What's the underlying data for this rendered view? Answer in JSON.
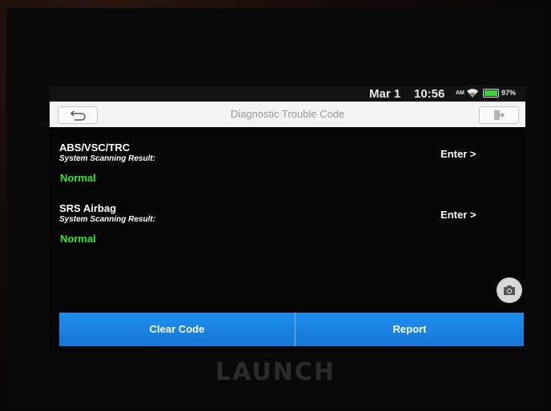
{
  "status_bar": {
    "date": "Mar 1",
    "time": "10:56",
    "ampm": "AM",
    "battery_percent": "97%",
    "battery_level": 0.97,
    "icons": [
      "wifi-icon",
      "battery-icon"
    ]
  },
  "header": {
    "title": "Diagnostic Trouble Code",
    "back_icon": "back-arrow-icon",
    "exit_icon": "exit-icon"
  },
  "systems": [
    {
      "name": "ABS/VSC/TRC",
      "result_label": "System Scanning Result:",
      "status": "Normal",
      "action": "Enter >"
    },
    {
      "name": "SRS Airbag",
      "result_label": "System Scanning Result:",
      "status": "Normal",
      "action": "Enter >"
    }
  ],
  "camera_icon": "camera-icon",
  "footer": {
    "clear_code": "Clear Code",
    "report": "Report"
  },
  "device": {
    "brand": "LAUNCH"
  },
  "colors": {
    "status_ok": "#2ee82e",
    "button_blue": "#1e8ff0",
    "screen_bg": "#050505"
  }
}
